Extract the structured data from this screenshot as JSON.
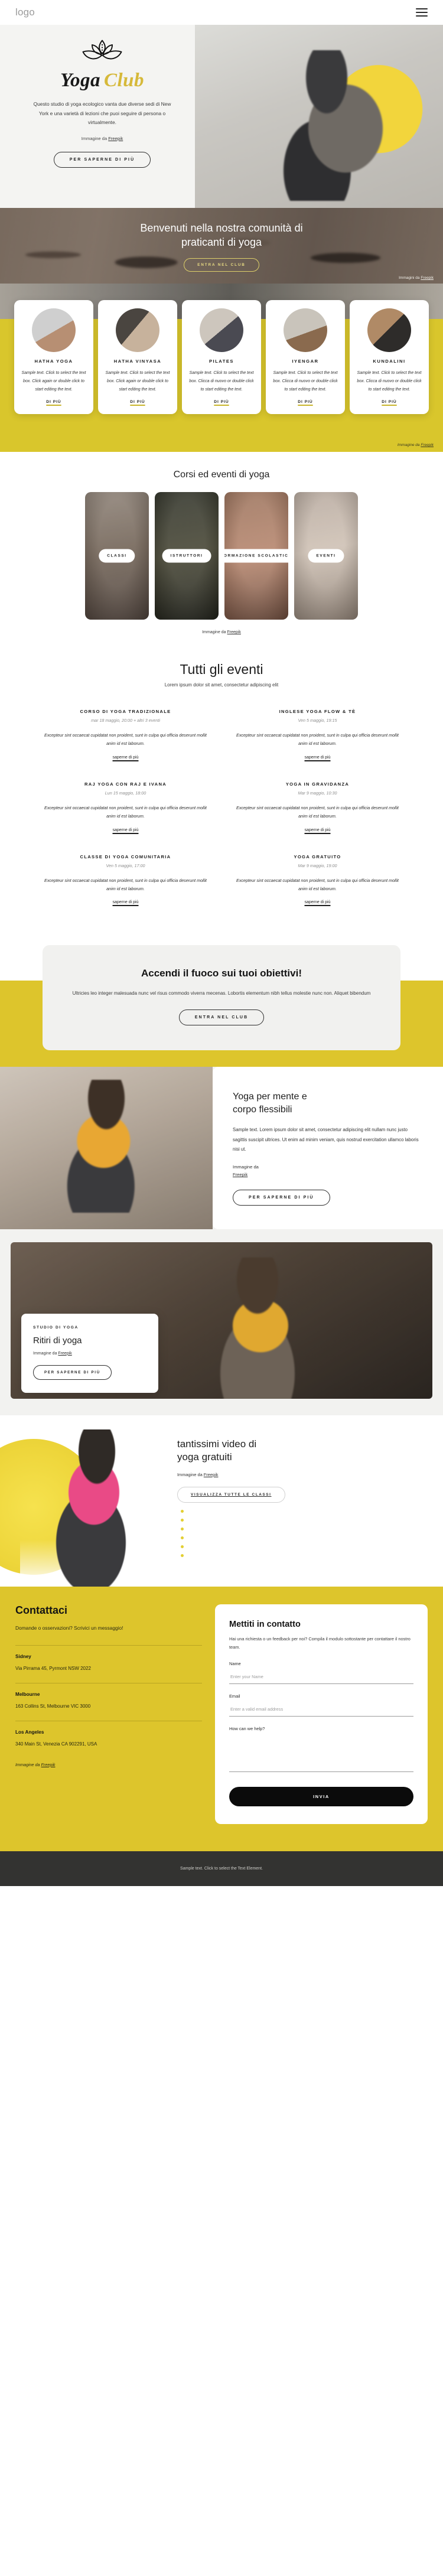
{
  "topbar": {
    "logo": "logo",
    "menu_icon": "hamburger-menu-icon"
  },
  "hero": {
    "brand_first": "Yoga",
    "brand_second": "Club",
    "description": "Questo studio di yoga ecologico vanta due diverse sedi di New York e una varietà di lezioni che puoi seguire di persona o virtualmente.",
    "credit_prefix": "Immagine da ",
    "credit_link": "Freepik",
    "cta": "PER SAPERNE DI PIÙ"
  },
  "welcome": {
    "title_line1": "Benvenuti nella nostra comunità di",
    "title_line2": "praticanti di yoga",
    "cta": "ENTRA NEL CLUB",
    "credit_prefix": "Immagini da ",
    "credit_link": "Freepik"
  },
  "styles": {
    "credit_prefix": "Immagine da ",
    "credit_link": "Freepik",
    "more_label": "DI PIÙ",
    "cards": [
      {
        "title": "HATHA YOGA",
        "text": "Sample text. Click to select the text box. Click again or double click to start editing the text."
      },
      {
        "title": "HATHA VINYASA",
        "text": "Sample text. Click to select the text box. Click again or double click to start editing the text."
      },
      {
        "title": "PILATES",
        "text": "Sample text. Click to select the text box. Clicca di nuovo or double click to start editing the text."
      },
      {
        "title": "IYENGAR",
        "text": "Sample text. Click to select the text box. Clicca di nuovo or double click to start editing the text."
      },
      {
        "title": "KUNDALINI",
        "text": "Sample text. Click to select the text box. Clicca di nuovo or double click to start editing the text."
      }
    ]
  },
  "courses": {
    "heading": "Corsi ed eventi di yoga",
    "credit_prefix": "Immagine da ",
    "credit_link": "Freepik",
    "items": [
      {
        "label": "CLASSI"
      },
      {
        "label": "ISTRUTTORI"
      },
      {
        "label": "FORMAZIONE SCOLASTICA"
      },
      {
        "label": "EVENTI"
      }
    ]
  },
  "events": {
    "heading": "Tutti gli eventi",
    "subheading": "Lorem ipsum dolor sit amet, consectetur adipiscing elit",
    "link_label": "saperne di più",
    "description": "Excepteur sint occaecat cupidatat non proident, sunt in culpa qui officia deserunt mollit anim id est laborum.",
    "items": [
      {
        "title": "CORSO DI YOGA TRADIZIONALE",
        "date": "mar 18 maggio, 20:00 + altri 3 eventi"
      },
      {
        "title": "INGLESE YOGA FLOW & TÈ",
        "date": "Ven 5 maggio, 19:15"
      },
      {
        "title": "RAJ YOGA CON RAJ E IVANA",
        "date": "Lun 15 maggio, 18:00"
      },
      {
        "title": "YOGA IN GRAVIDANZA",
        "date": "Mar 9 maggio, 10:30"
      },
      {
        "title": "CLASSE DI YOGA COMUNITARIA",
        "date": "Ven 5 maggio, 17:00"
      },
      {
        "title": "YOGA GRATUITO",
        "date": "Mar 9 maggio, 19:00"
      }
    ]
  },
  "cta": {
    "title": "Accendi il fuoco sui tuoi obiettivi!",
    "text": "Ultricies leo integer malesuada nunc vel risus commodo viverra mecenas. Lobortis elementum nibh tellus molestie nunc non. Aliquet bibendum",
    "button": "ENTRA NEL CLUB"
  },
  "flex_section": {
    "heading_line1": "Yoga per mente e",
    "heading_line2": "corpo flessibili",
    "text": "Sample text. Lorem ipsum dolor sit amet, consectetur adipiscing elit nullam nunc justo sagittis suscipit ultrices. Ut enim ad minim veniam, quis nostrud exercitation ullamco laboris nisi ut.",
    "credit_prefix": "Immagine da",
    "credit_link": "Freepik",
    "button": "PER SAPERNE DI PIÙ"
  },
  "retreat": {
    "kicker": "STUDIO DI YOGA",
    "title": "Ritiri di yoga",
    "credit_prefix": "Immagine da ",
    "credit_link": "Freepik",
    "button": "PER SAPERNE DI PIÙ"
  },
  "video": {
    "heading_line1": "tantissimi video di",
    "heading_line2": "yoga gratuiti",
    "credit_prefix": "Immagine da ",
    "credit_link": "Freepik",
    "button": "VISUALIZZA TUTTE LE CLASSI"
  },
  "contact": {
    "heading": "Contattaci",
    "subheading": "Domande o osservazioni? Scrivici un messaggio!",
    "locations": [
      {
        "city": "Sidney",
        "address": "Via Pirrama 45, Pyrmont NSW 2022"
      },
      {
        "city": "Melbourne",
        "address": "163 Collins St, Melbourne VIC 3000"
      },
      {
        "city": "Los Angeles",
        "address": "340 Main St, Venezia CA 902291, USA"
      }
    ],
    "credit_prefix": "Immagine da ",
    "credit_link": "Freepik",
    "form": {
      "heading": "Mettiti in contatto",
      "intro": "Hai una richiesta o un feedback per noi? Compila il modulo sottostante per contattare il nostro team.",
      "name_label": "Name",
      "name_placeholder": "Enter your Name",
      "email_label": "Email",
      "email_placeholder": "Enter a valid email address",
      "message_label": "How can we help?",
      "message_placeholder": "",
      "submit": "INVIA"
    }
  },
  "footer": {
    "text": "Sample text. Click to select the Text Element."
  },
  "colors": {
    "brand_yellow": "#ddc52c",
    "gold": "#d6b93a",
    "dark": "#333331"
  }
}
